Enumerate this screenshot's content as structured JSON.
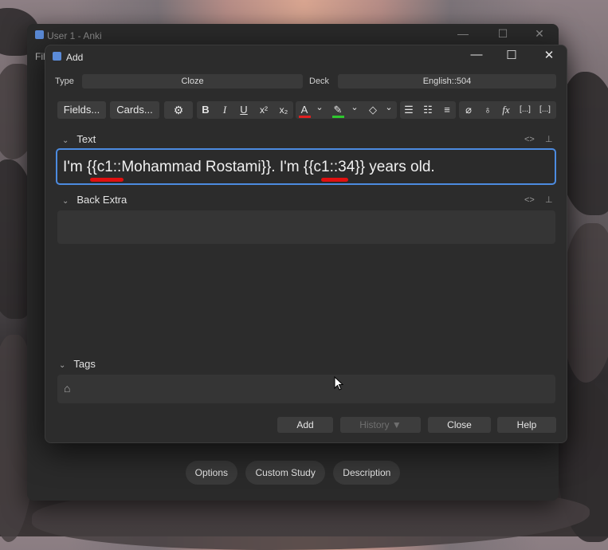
{
  "main_window": {
    "title": "User 1 - Anki",
    "menu_partial": "Fil",
    "controls": {
      "minimize": "—",
      "maximize": "☐",
      "close": "✕"
    },
    "bottom_buttons": [
      "Options",
      "Custom Study",
      "Description"
    ]
  },
  "dialog": {
    "title": "Add",
    "controls": {
      "minimize": "—",
      "maximize": "☐",
      "close": "✕"
    },
    "type_label": "Type",
    "type_value": "Cloze",
    "deck_label": "Deck",
    "deck_value": "English::504",
    "toolbar": {
      "fields_label": "Fields...",
      "cards_label": "Cards...",
      "icons": [
        "gear-icon",
        "bold-icon",
        "italic-icon",
        "underline-icon",
        "superscript-icon",
        "subscript-icon",
        "text-color-icon",
        "highlight-icon",
        "eraser-icon",
        "bullet-list-icon",
        "numbered-list-icon",
        "align-icon",
        "attach-icon",
        "microphone-icon",
        "formula-icon",
        "cloze-icon",
        "cloze-same-icon"
      ],
      "glyphs": {
        "bold": "B",
        "italic": "I",
        "underline": "U",
        "superscript": "x²",
        "subscript": "x₂",
        "text_color": "A",
        "dropdown": "⌄",
        "formula": "fx",
        "cloze": "[...]",
        "cloze_same": "[...]"
      },
      "colors": {
        "text_color_bar": "#e02020",
        "highlight_bar": "#2ec82e"
      }
    },
    "fields": [
      {
        "name": "Text",
        "value": "I'm {{c1::Mohammad Rostami}}. I'm {{c1::34}} years old."
      },
      {
        "name": "Back Extra",
        "value": ""
      }
    ],
    "field_tools": {
      "html": "<>",
      "pin": "⊥"
    },
    "tags_label": "Tags",
    "footer_buttons": {
      "add": "Add",
      "history": "History ▼",
      "close": "Close",
      "help": "Help"
    }
  },
  "colors": {
    "accent_border": "#4c8be0",
    "annotation_red": "#e01010"
  }
}
